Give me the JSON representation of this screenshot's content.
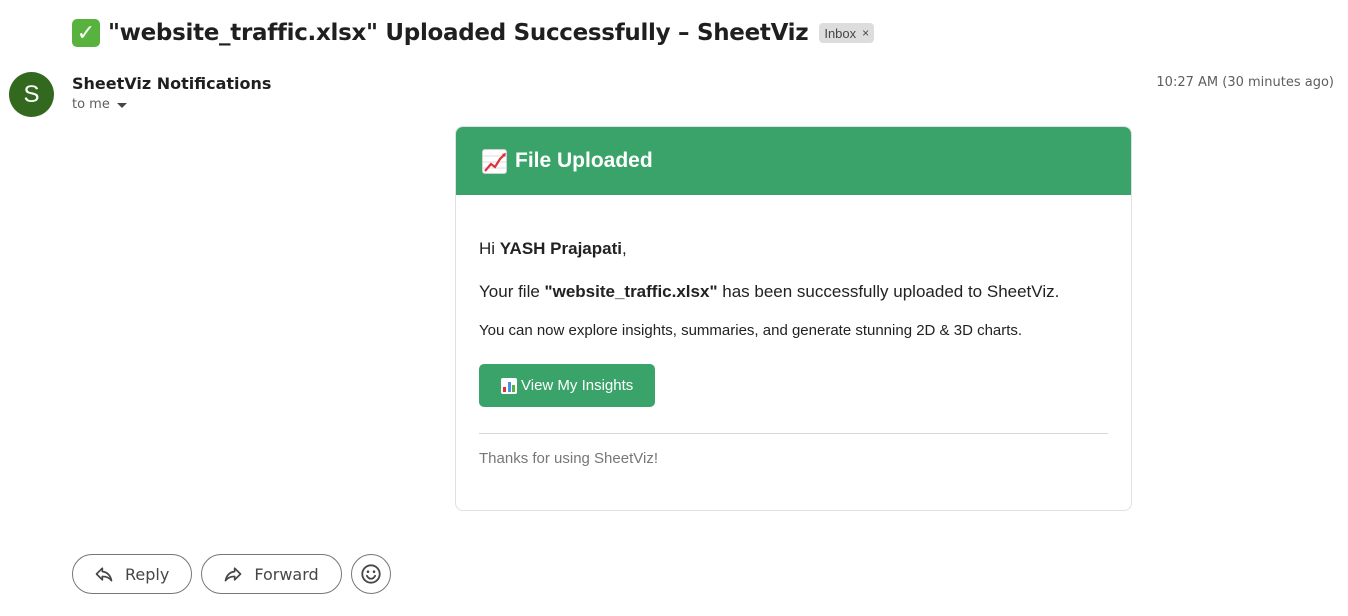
{
  "subject": {
    "check_icon": "check-mark-button-emoji",
    "text": "\"website_traffic.xlsx\" Uploaded Successfully – SheetViz",
    "label_chip": "Inbox",
    "chip_close": "×"
  },
  "sender": {
    "avatar_letter": "S",
    "avatar_color": "#33691e",
    "name": "SheetViz Notifications",
    "recipient": "to me",
    "timestamp": "10:27 AM (30 minutes ago)"
  },
  "email": {
    "accent_color": "#3aa36a",
    "header_title": "File Uploaded",
    "greeting_prefix": "Hi ",
    "user_name": "YASH Prajapati",
    "greeting_suffix": ",",
    "upload_prefix": "Your file ",
    "file_name": "\"website_traffic.xlsx\"",
    "upload_suffix": " has been successfully uploaded to SheetViz.",
    "explore_text": "You can now explore insights, summaries, and generate stunning 2D & 3D charts.",
    "cta_label": "View My Insights",
    "thanks_text": "Thanks for using SheetViz!"
  },
  "actions": {
    "reply_label": "Reply",
    "forward_label": "Forward",
    "emoji_icon": "smiley-icon"
  }
}
